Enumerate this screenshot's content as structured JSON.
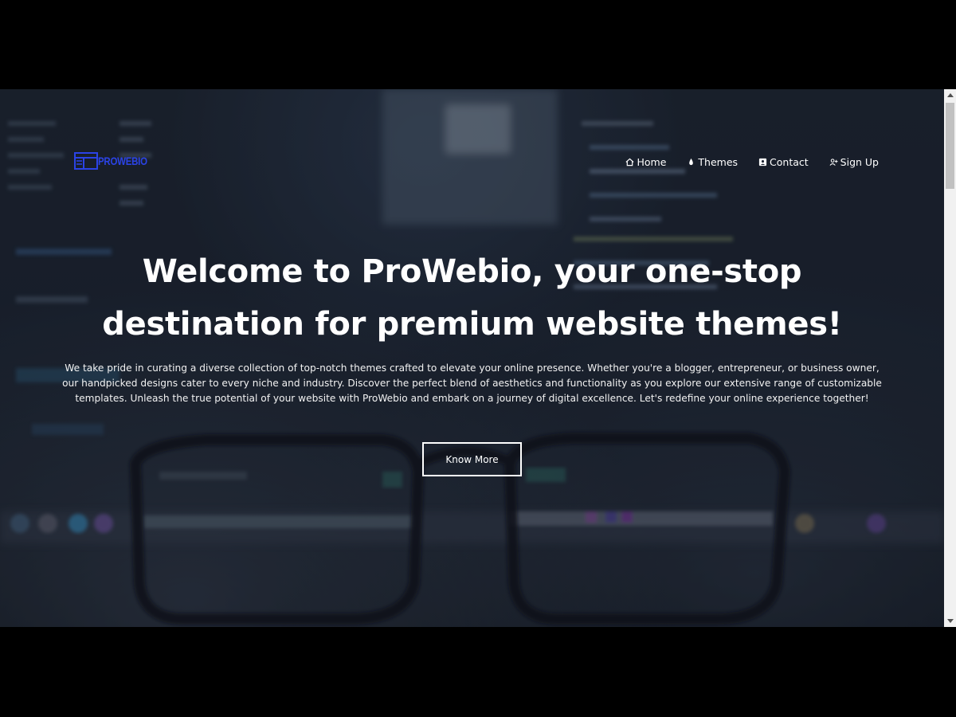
{
  "brand": {
    "logo_text": "PROWEBIO",
    "logo_color": "#2b43e6"
  },
  "nav": {
    "items": [
      {
        "label": "Home",
        "icon": "home-icon"
      },
      {
        "label": "Themes",
        "icon": "drop-icon"
      },
      {
        "label": "Contact",
        "icon": "contact-card-icon"
      },
      {
        "label": "Sign Up",
        "icon": "user-plus-icon"
      }
    ]
  },
  "hero": {
    "title": "Welcome to ProWebio, your one-stop destination for premium website themes!",
    "description": "We take pride in curating a diverse collection of top-notch themes crafted to elevate your online presence. Whether you're a blogger, entrepreneur, or business owner, our handpicked designs cater to every niche and industry. Discover the perfect blend of aesthetics and functionality as you explore our extensive range of customizable templates. Unleash the true potential of your website with ProWebio and embark on a journey of digital excellence. Let's redefine your online experience together!",
    "cta_label": "Know More"
  }
}
